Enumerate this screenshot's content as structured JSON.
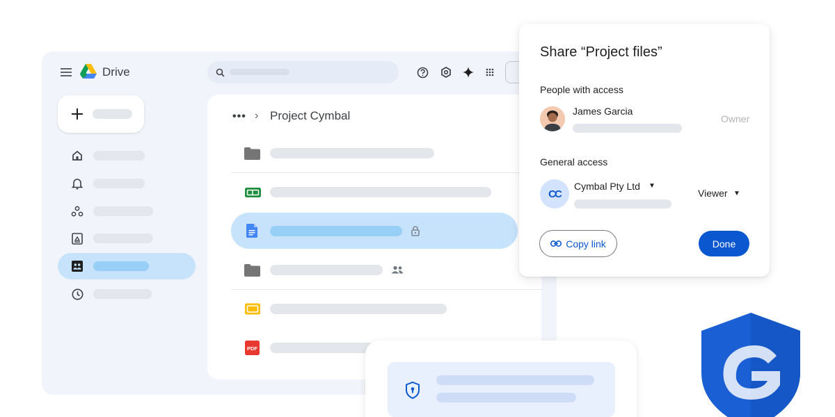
{
  "app": {
    "name": "Drive"
  },
  "breadcrumb": {
    "more": "•••",
    "separator": "›",
    "current": "Project Cymbal"
  },
  "share_dialog": {
    "title": "Share “Project files”",
    "people_section": "People with access",
    "person": {
      "name": "James Garcia",
      "role": "Owner"
    },
    "general_section": "General access",
    "organization": {
      "name": "Cymbal Pty Ltd",
      "logo": "CC",
      "role": "Viewer"
    },
    "copy_link_label": "Copy link",
    "done_label": "Done"
  },
  "file_list": {
    "icons": [
      "folder-icon",
      "sheets-icon",
      "docs-icon",
      "folder-icon",
      "slides-icon",
      "pdf-icon"
    ],
    "pdf_badge": "PDF"
  },
  "colors": {
    "accent": "#0b57d0",
    "selection": "#c6e3fb",
    "window_bg": "#f1f4fa",
    "shield_blue": "#1a5fd4"
  }
}
